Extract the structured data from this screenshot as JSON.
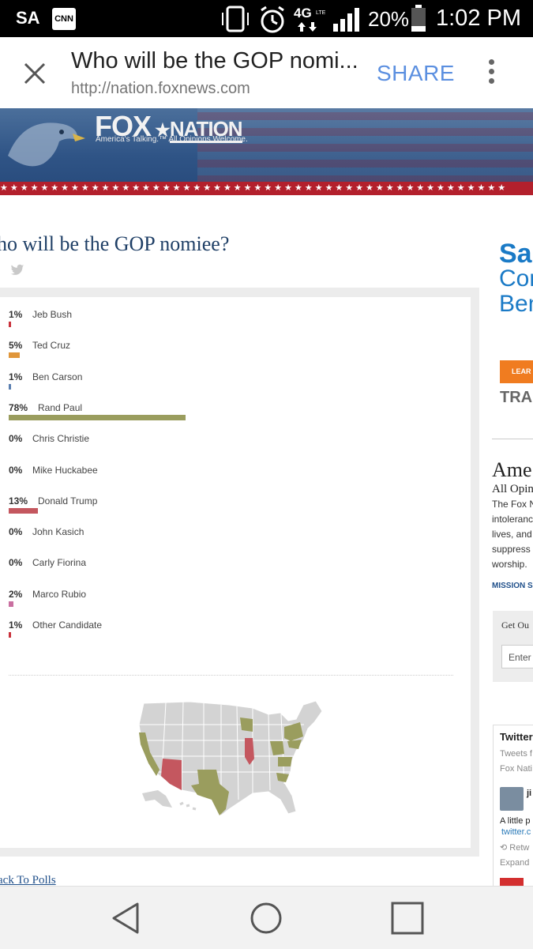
{
  "status_bar": {
    "carrier": "SA",
    "app_badge": "CNN",
    "network": "4G LTE",
    "battery": "20%",
    "time": "1:02 PM"
  },
  "browser": {
    "title": "Who will be the GOP nomi...",
    "url": "http://nation.foxnews.com",
    "share_label": "SHARE"
  },
  "banner": {
    "logo_fox": "FOX",
    "logo_nation": "NATION",
    "tagline": "America's Talking.™ All Opinions Welcome."
  },
  "poll": {
    "question": "ho will be the GOP nomiee?",
    "candidates": [
      {
        "name": "Jeb Bush",
        "pct": "1%",
        "value": 1,
        "color": "#c9323c"
      },
      {
        "name": "Ted Cruz",
        "pct": "5%",
        "value": 5,
        "color": "#e0963a"
      },
      {
        "name": "Ben Carson",
        "pct": "1%",
        "value": 1,
        "color": "#5a7fb0"
      },
      {
        "name": "Rand Paul",
        "pct": "78%",
        "value": 78,
        "color": "#9a9d5e"
      },
      {
        "name": "Chris Christie",
        "pct": "0%",
        "value": 0,
        "color": "#999999"
      },
      {
        "name": "Mike Huckabee",
        "pct": "0%",
        "value": 0,
        "color": "#999999"
      },
      {
        "name": "Donald Trump",
        "pct": "13%",
        "value": 13,
        "color": "#c4575f"
      },
      {
        "name": "John Kasich",
        "pct": "0%",
        "value": 0,
        "color": "#999999"
      },
      {
        "name": "Carly Fiorina",
        "pct": "0%",
        "value": 0,
        "color": "#999999"
      },
      {
        "name": "Marco Rubio",
        "pct": "2%",
        "value": 2,
        "color": "#c96fa0"
      },
      {
        "name": "Other Candidate",
        "pct": "1%",
        "value": 1,
        "color": "#c9323c"
      }
    ],
    "back_link": "ack To Polls"
  },
  "chart_data": {
    "type": "bar",
    "categories": [
      "Jeb Bush",
      "Ted Cruz",
      "Ben Carson",
      "Rand Paul",
      "Chris Christie",
      "Mike Huckabee",
      "Donald Trump",
      "John Kasich",
      "Carly Fiorina",
      "Marco Rubio",
      "Other Candidate"
    ],
    "values": [
      1,
      5,
      1,
      78,
      0,
      0,
      13,
      0,
      0,
      2,
      1
    ],
    "title": "",
    "xlabel": "",
    "ylabel": ""
  },
  "sidebar": {
    "ad_line1": "Sa",
    "ad_line2": "Cor",
    "ad_line3": "Ben",
    "ad_button": "LEAR",
    "ad_brand": "TRA",
    "about_title": "Ame",
    "about_sub": "All Opin",
    "about_lines": [
      "The Fox N",
      "intoleranc",
      "lives, and",
      "suppress",
      "worship."
    ],
    "mission_link": "MISSION S",
    "newsletter_title": "Get Ou",
    "newsletter_placeholder": "Enter",
    "twitter_title": "Twitter",
    "twitter_sub1": "Tweets f",
    "twitter_sub2": "Fox Nati",
    "tweet_author": "ji",
    "tweet_text": "A little p",
    "tweet_link": "twitter.c",
    "tweet_retweet": "Retw",
    "tweet_expand": "Expand"
  }
}
